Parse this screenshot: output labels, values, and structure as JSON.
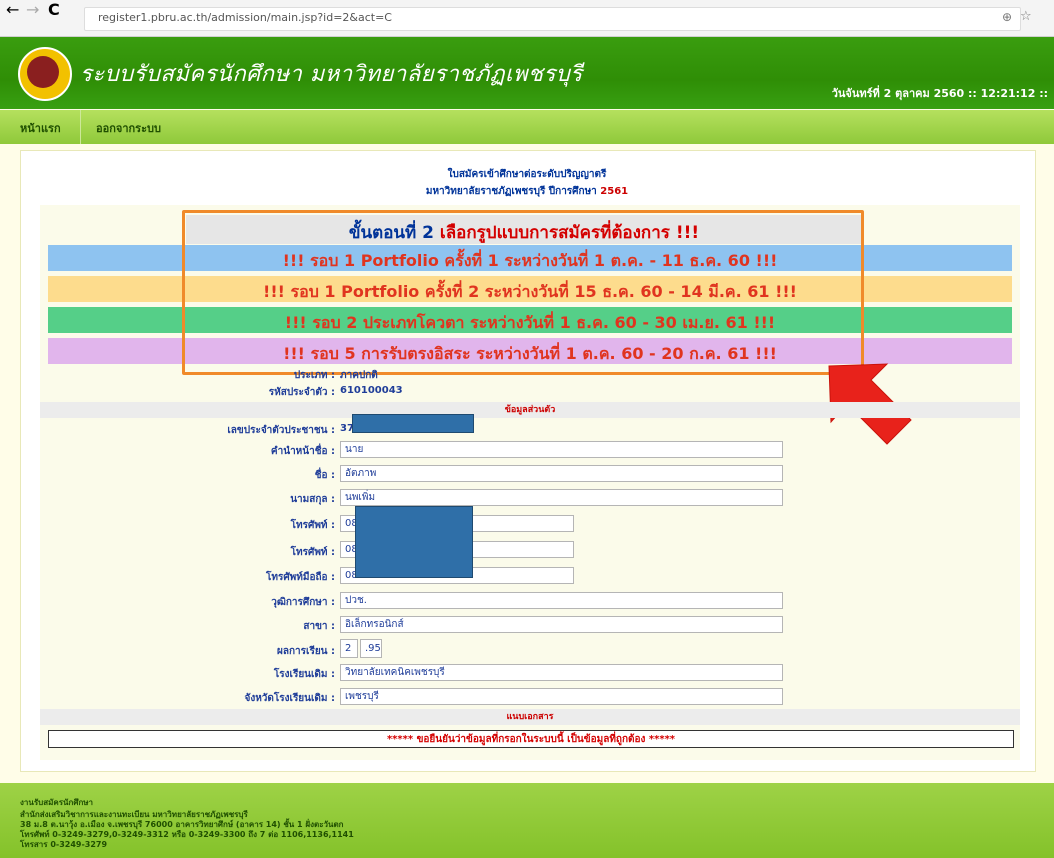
{
  "browser": {
    "back": "←",
    "forward": "→",
    "reload": "C",
    "url": "register1.pbru.ac.th/admission/main.jsp?id=2&act=C",
    "zoom_icon": "⊕",
    "star_icon": "☆"
  },
  "header": {
    "site_title": "ระบบรับสมัครนักศึกษา มหาวิทยาลัยราชภัฏเพชรบุรี",
    "datetime": "วันจันทร์ที่ 2 ตุลาคม 2560 :: 12:21:12 ::"
  },
  "menu": {
    "home": "หน้าแรก",
    "logout": "ออกจากระบบ"
  },
  "document": {
    "title_line1": "ใบสมัครเข้าศึกษาต่อระดับปริญญาตรี",
    "title_line2": "มหาวิทยาลัยราชภัฏเพชรบุรี ปีการศึกษา",
    "year": "2561"
  },
  "step": {
    "prefix": "ขั้นตอนที่ 2",
    "text": "เลือกรูปแบบการสมัครที่ต้องการ !!!"
  },
  "rounds": [
    {
      "text": "!!! รอบ 1 Portfolio ครั้งที่ 1 ระหว่างวันที่ 1 ต.ค. - 11 ธ.ค. 60 !!!",
      "color": "#8ec3f0"
    },
    {
      "text": "!!! รอบ 1 Portfolio ครั้งที่ 2 ระหว่างวันที่ 15 ธ.ค. 60 - 14 มี.ค. 61 !!!",
      "color": "#fddc8d"
    },
    {
      "text": "!!! รอบ 2 ประเภทโควตา ระหว่างวันที่ 1 ธ.ค. 60 - 30 เม.ย. 61 !!!",
      "color": "#55cf88"
    },
    {
      "text": "!!! รอบ 5 การรับตรงอิสระ ระหว่างวันที่ 1 ต.ค. 60 - 20 ก.ค. 61 !!!",
      "color": "#e1b5ec"
    }
  ],
  "form": {
    "type_label": "ประเภท :",
    "type_value": "ภาคปกติ",
    "id_label": "รหัสประจำตัว :",
    "id_value": "610100043",
    "section_personal": "ข้อมูลส่วนตัว",
    "citizen_label": "เลขประจำตัวประชาชน :",
    "citizen_value": "37",
    "prefix_label": "คำนำหน้าชื่อ :",
    "prefix_value": "นาย",
    "firstname_label": "ชื่อ :",
    "firstname_value": "อัตภาพ",
    "lastname_label": "นามสกุล :",
    "lastname_value": "นพเพิ่ม",
    "phone1_label": "โทรศัพท์ :",
    "phone1_value": "08",
    "phone2_label": "โทรศัพท์ :",
    "phone2_value": "08",
    "mobile_label": "โทรศัพท์มือถือ :",
    "mobile_value": "08",
    "degree_label": "วุฒิการศึกษา :",
    "degree_value": "ปวช.",
    "major_label": "สาขา :",
    "major_value": "อิเล็กทรอนิกส์",
    "gpa_label": "ผลการเรียน :",
    "gpa_int": "2",
    "gpa_dec": ".95",
    "school_label": "โรงเรียนเดิม :",
    "school_value": "วิทยาลัยเทคนิคเพชรบุรี",
    "province_label": "จังหวัดโรงเรียนเดิม :",
    "province_value": "เพชรบุรี",
    "section_docs": "แนบเอกสาร",
    "confirm": "***** ขอยืนยันว่าข้อมูลที่กรอกในระบบนี้ เป็นข้อมูลที่ถูกต้อง *****"
  },
  "footer": {
    "line1": "งานรับสมัครนักศึกษา",
    "line2": "สำนักส่งเสริมวิชาการและงานทะเบียน มหาวิทยาลัยราชภัฏเพชรบุรี",
    "line3": "38 ม.8 ต.นาวุ้ง อ.เมือง จ.เพชรบุรี 76000 อาคารวิทยาศึกษ์ (อาคาร 14) ชั้น 1 ฝั่งตะวันตก",
    "line4": "โทรศัพท์ 0-3249-3279,0-3249-3312 หรือ 0-3249-3300 ถึง 7 ต่อ 1106,1136,1141",
    "line5": "โทรสาร 0-3249-3279"
  },
  "colors": {
    "header_green": "#2f8e06",
    "highlight_orange": "#f08a2a",
    "arrow_red": "#e8221b",
    "mask_blue": "#2f6fa8"
  }
}
